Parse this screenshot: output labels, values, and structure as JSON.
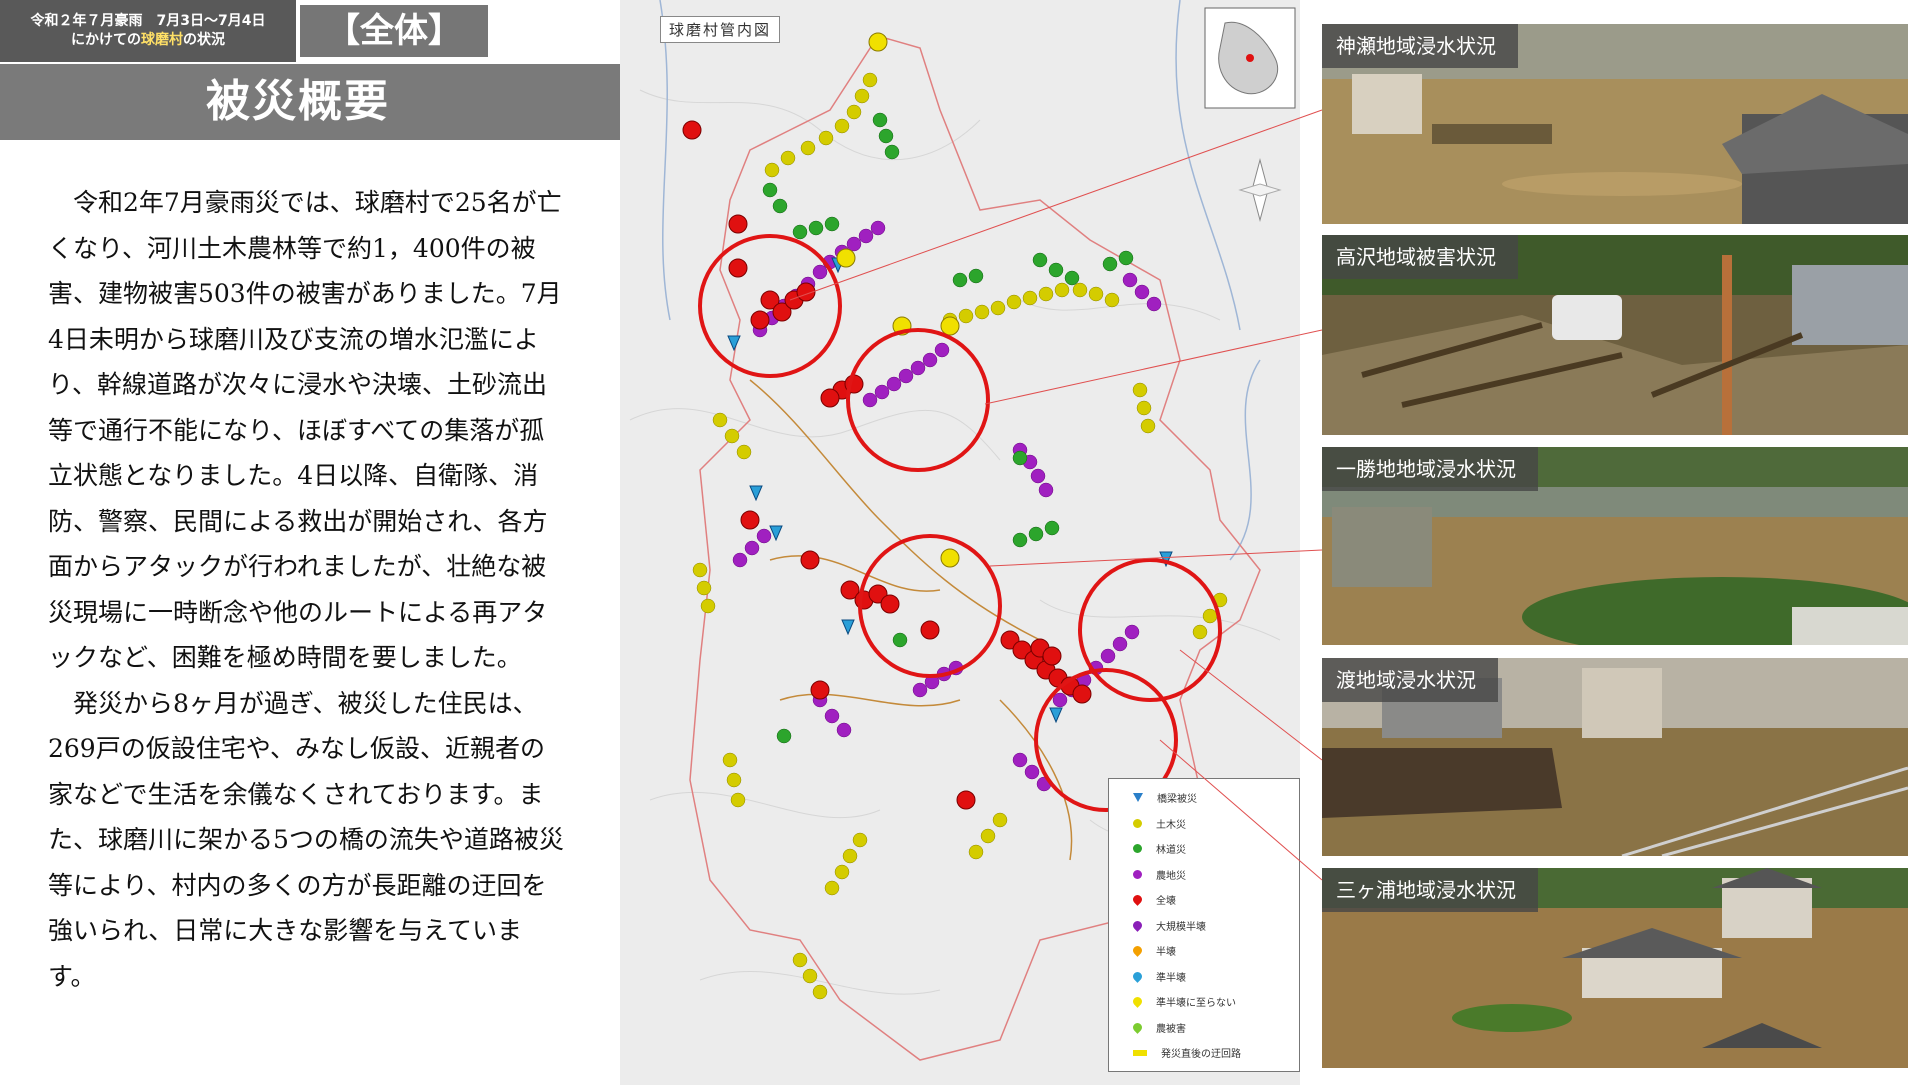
{
  "header": {
    "line1": "令和２年７月豪雨　7月3日～7月4日",
    "line2_pre": "にかけての",
    "line2_highlight": "球磨村",
    "line2_post": "の状況",
    "tag": "【全体】",
    "title": "被災概要"
  },
  "body": {
    "paragraph1": "令和2年7月豪雨災では、球磨村で25名が亡くなり、河川土木農林等で約1，400件の被害、建物被害503件の被害がありました。7月4日未明から球磨川及び支流の増水氾濫により、幹線道路が次々に浸水や決壊、土砂流出等で通行不能になり、ほぼすべての集落が孤立状態となりました。4日以降、自衛隊、消防、警察、民間による救出が開始され、各方面からアタックが行われましたが、壮絶な被災現場に一時断念や他のルートによる再アタックなど、困難を極め時間を要しました。",
    "paragraph2": "発災から8ヶ月が過ぎ、被災した住民は、269戸の仮設住宅や、みなし仮設、近親者の家などで生活を余儀なくされております。また、球磨川に架かる5つの橋の流失や道路被災等により、村内の多くの方が長距離の迂回を強いられ、日常に大きな影響を与えています。"
  },
  "map": {
    "title": "球磨村管内図",
    "legend": [
      {
        "label": "橋梁被災",
        "color": "#2a7fc9",
        "icon": "triangle-marker"
      },
      {
        "label": "土木災",
        "color": "#d4cc00",
        "icon": "dot"
      },
      {
        "label": "林道災",
        "color": "#2ca52c",
        "icon": "dot"
      },
      {
        "label": "農地災",
        "color": "#a020c0",
        "icon": "dot"
      },
      {
        "label": "全壊",
        "color": "#e01010",
        "icon": "pin"
      },
      {
        "label": "大規模半壊",
        "color": "#8a1fb8",
        "icon": "pin"
      },
      {
        "label": "半壊",
        "color": "#f4a000",
        "icon": "pin"
      },
      {
        "label": "準半壊",
        "color": "#2aa0d8",
        "icon": "pin"
      },
      {
        "label": "準半壊に至らない",
        "color": "#f0e000",
        "icon": "pin"
      },
      {
        "label": "農被害",
        "color": "#7ccc30",
        "icon": "pin"
      },
      {
        "label": "発災直後の迂回路",
        "color": "#f0e000",
        "icon": "bar"
      }
    ]
  },
  "photos": [
    {
      "caption": "神瀬地域浸水状況"
    },
    {
      "caption": "高沢地域被害状況"
    },
    {
      "caption": "一勝地地域浸水状況"
    },
    {
      "caption": "渡地域浸水状況"
    },
    {
      "caption": "三ヶ浦地域浸水状況"
    }
  ],
  "colors": {
    "header_dark": "#595959",
    "header_bar": "#7a7a7a",
    "circle_red": "#e01515",
    "flood_water": "#9c8150"
  }
}
